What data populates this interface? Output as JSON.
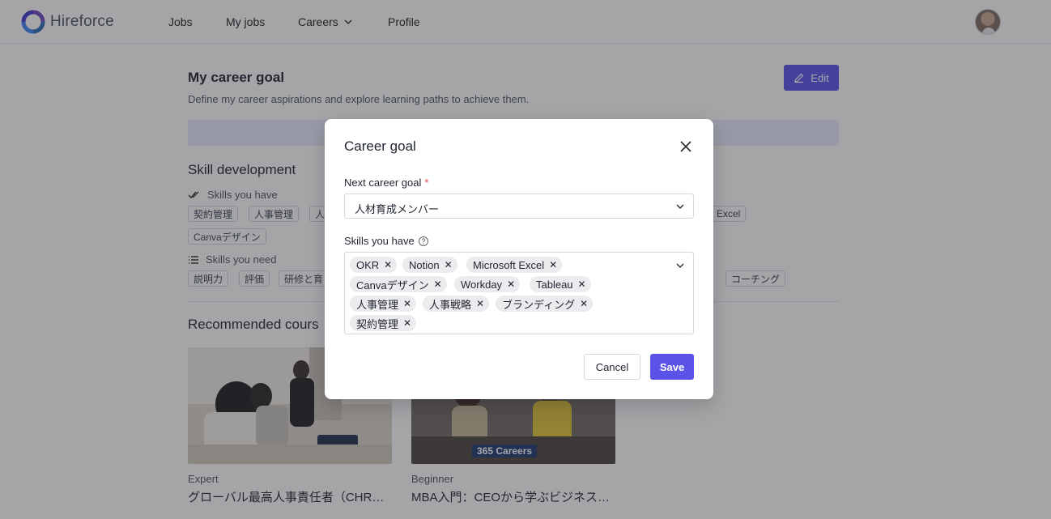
{
  "brand": {
    "name": "Hireforce"
  },
  "nav": {
    "jobs": "Jobs",
    "my_jobs": "My jobs",
    "careers": "Careers",
    "profile": "Profile"
  },
  "page": {
    "title": "My career goal",
    "subtitle": "Define my career aspirations and explore learning paths to achieve them.",
    "edit_label": "Edit"
  },
  "skill_development": {
    "title": "Skill development",
    "have_label": "Skills you have",
    "have_chips": [
      "契約管理",
      "人事管理",
      "人",
      "ft Excel"
    ],
    "have_chips_row2": [
      "Canvaデザイン"
    ],
    "need_label": "Skills you need",
    "need_chips": [
      "説明力",
      "評価",
      "研修と育",
      "コーチング"
    ]
  },
  "recommended": {
    "title": "Recommended cours",
    "courses": [
      {
        "level": "Expert",
        "title": "グローバル最高人事責任者（CHRO）"
      },
      {
        "level": "Beginner",
        "title": "MBA入門：CEOから学ぶビジネスの基本",
        "image_badge": "365 Careers"
      }
    ]
  },
  "modal": {
    "title": "Career goal",
    "next_goal_label": "Next career goal",
    "required_mark": "*",
    "next_goal_value": "人材育成メンバー",
    "skills_label": "Skills you have",
    "skills": [
      "OKR",
      "Notion",
      "Microsoft Excel",
      "Canvaデザイン",
      "Workday",
      "Tableau",
      "人事管理",
      "人事戦略",
      "ブランディング",
      "契約管理"
    ],
    "remove_glyph": "✕",
    "cancel_label": "Cancel",
    "save_label": "Save"
  },
  "colors": {
    "accent": "#5b52e8",
    "overlay": "rgba(40,40,48,0.42)",
    "banner": "#e7ecfb"
  },
  "icons": [
    "hireforce-logo-icon",
    "chevron-down-icon",
    "pencil-icon",
    "double-check-icon",
    "list-icon",
    "close-icon",
    "help-circle-icon"
  ]
}
